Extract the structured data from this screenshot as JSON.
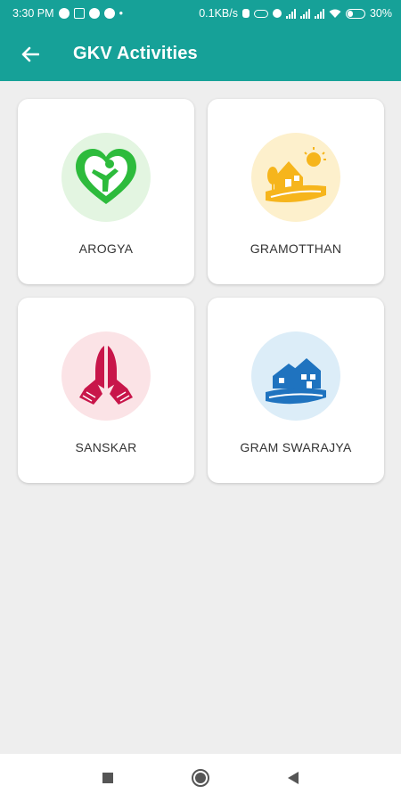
{
  "status_bar": {
    "time": "3:30 PM",
    "network_speed": "0.1KB/s",
    "battery": "30%"
  },
  "header": {
    "title": "GKV Activities",
    "back_icon": "arrow-left-icon"
  },
  "activities": [
    {
      "label": "AROGYA",
      "icon": "heart-person-icon",
      "icon_color": "#2dbb3c",
      "bg_color": "#e3f5e1"
    },
    {
      "label": "GRAMOTTHAN",
      "icon": "village-sun-icon",
      "icon_color": "#f6b51c",
      "bg_color": "#fdf0cc"
    },
    {
      "label": "SANSKAR",
      "icon": "folded-hands-icon",
      "icon_color": "#c8164a",
      "bg_color": "#fbe3e6"
    },
    {
      "label": "GRAM SWARAJYA",
      "icon": "houses-icon",
      "icon_color": "#1f73bf",
      "bg_color": "#dcedf8"
    }
  ],
  "colors": {
    "primary": "#16a198",
    "background": "#eeeeee"
  },
  "nav": {
    "recent": "square-icon",
    "home": "circle-icon",
    "back": "triangle-back-icon"
  }
}
